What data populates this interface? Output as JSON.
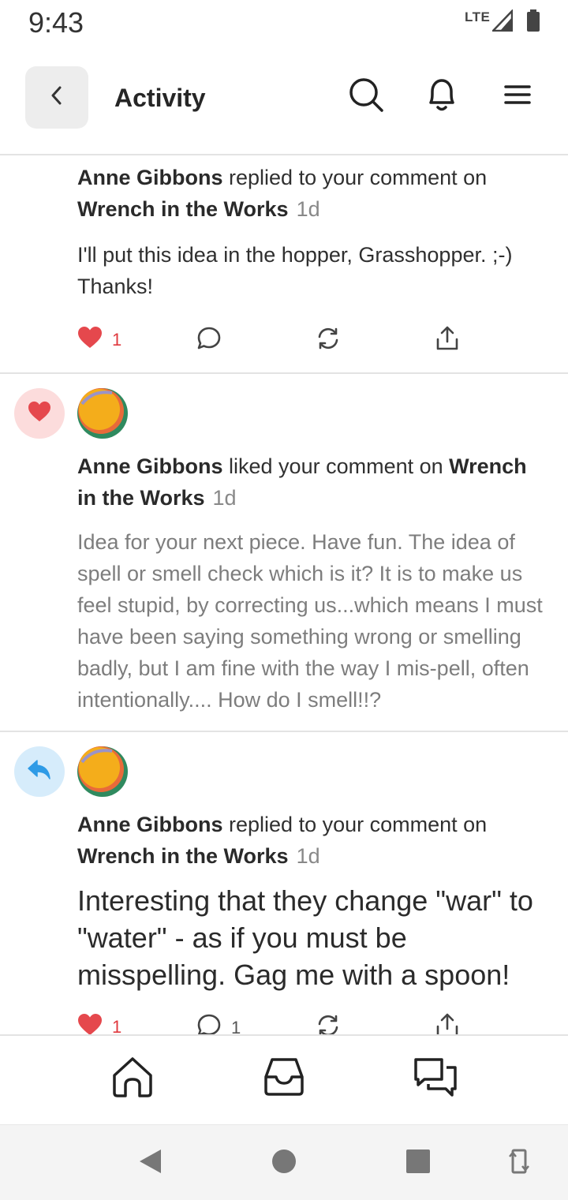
{
  "status_bar": {
    "time": "9:43",
    "network": "LTE"
  },
  "header": {
    "title": "Activity"
  },
  "notifications": [
    {
      "type": "reply",
      "actor": "Anne Gibbons",
      "action": "replied to your comment on",
      "target": "Wrench in the Works",
      "time": "1d",
      "excerpt": "I'll put this idea in the hopper, Grasshopper. ;-) Thanks!",
      "like_count": "1"
    },
    {
      "type": "like",
      "actor": "Anne Gibbons",
      "action": "liked your comment on",
      "target": "Wrench in the Works",
      "time": "1d",
      "excerpt": "Idea for your next piece. Have fun. The idea of spell or smell check which is it? It is to make us feel stupid, by correcting us...which means I must have been saying something wrong or smelling badly, but I am fine with the way I mis-pell, often intentionally.... How do I smell!!?"
    },
    {
      "type": "reply",
      "actor": "Anne Gibbons",
      "action": "replied to your comment on",
      "target": "Wrench in the Works",
      "time": "1d",
      "excerpt": "Interesting that they change \"war\" to \"water\" - as if you must be misspelling. Gag me with a spoon!",
      "like_count": "1",
      "reply_count": "1"
    }
  ],
  "colors": {
    "like_red": "#e5484d",
    "like_badge_bg": "#fcdcdc",
    "reply_blue": "#2f9be6",
    "reply_badge_bg": "#d6ecfb",
    "divider": "#e3e3e3"
  },
  "icons": {
    "header": [
      "chevron-left-icon",
      "search-icon",
      "bell-icon",
      "menu-icon"
    ],
    "actions": [
      "heart-icon",
      "comment-icon",
      "restack-icon",
      "share-icon"
    ],
    "bottom_nav": [
      "home-icon",
      "inbox-icon",
      "chat-icon"
    ],
    "system_nav": [
      "back-triangle-icon",
      "home-circle-icon",
      "recents-square-icon",
      "rotate-icon"
    ]
  }
}
